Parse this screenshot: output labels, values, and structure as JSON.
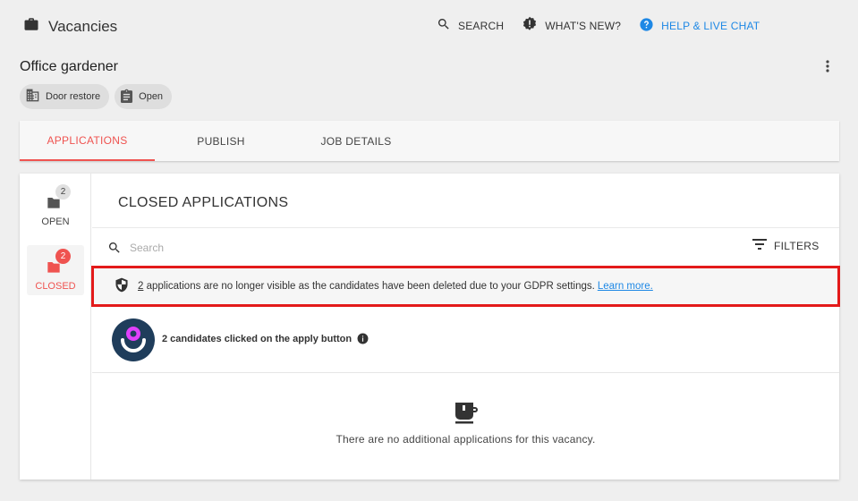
{
  "header": {
    "app_title": "Vacancies",
    "actions": [
      {
        "label": "SEARCH",
        "icon": "search-icon"
      },
      {
        "label": "WHAT'S NEW?",
        "icon": "alert-badge-icon"
      },
      {
        "label": "HELP & LIVE CHAT",
        "icon": "help-circle-icon"
      }
    ]
  },
  "vacancy": {
    "title": "Office gardener",
    "chips": [
      {
        "label": "Door restore",
        "icon": "building-icon"
      },
      {
        "label": "Open",
        "icon": "clipboard-icon"
      }
    ]
  },
  "tabs": [
    {
      "label": "APPLICATIONS",
      "active": true
    },
    {
      "label": "PUBLISH",
      "active": false
    },
    {
      "label": "JOB DETAILS",
      "active": false
    }
  ],
  "sidebar": {
    "items": [
      {
        "label": "OPEN",
        "count": "2",
        "active": false
      },
      {
        "label": "CLOSED",
        "count": "2",
        "active": true
      }
    ]
  },
  "main": {
    "section_title": "CLOSED APPLICATIONS",
    "search_placeholder": "Search",
    "filters_label": "FILTERS",
    "gdpr": {
      "count": "2",
      "text": " applications are no longer visible as the candidates have been deleted due to your GDPR settings.",
      "link": "Learn more."
    },
    "clicked_text": "2 candidates clicked on the apply button",
    "empty_text": "There are no additional applications for this vacancy."
  },
  "colors": {
    "accent": "#ef5350",
    "link": "#1e88e5",
    "highlight_border": "#e31a1a",
    "avatar_bg": "#1f3d5b"
  }
}
